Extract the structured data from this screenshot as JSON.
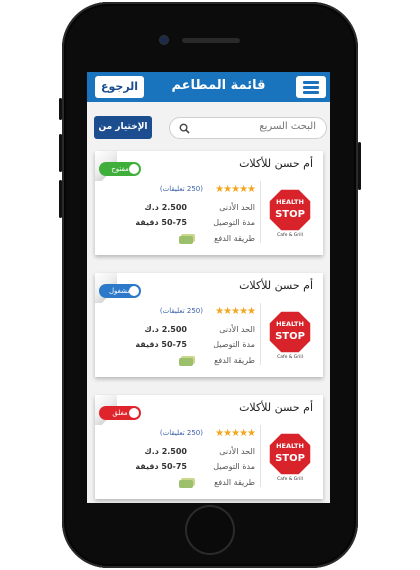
{
  "header": {
    "title": "قائمة المطاعم",
    "back_label": "الرجوع"
  },
  "search": {
    "placeholder": "البحث السريع"
  },
  "filter": {
    "label": "الإختيار من"
  },
  "restaurants": [
    {
      "name": "أم حسن للأكلات",
      "rating": 5,
      "reviews": "(250 تعليقات)",
      "min_label": "الحد الأدنى",
      "min_value": "2.500 د.ك",
      "delivery_label": "مدة التوصيل",
      "delivery_value": "50-75 دقيقة",
      "payment_label": "طريقة الدفع",
      "status": "مفتوح",
      "status_color": "#3fae3a"
    },
    {
      "name": "أم حسن للأكلات",
      "rating": 5,
      "reviews": "(250 تعليقات)",
      "min_label": "الحد الأدنى",
      "min_value": "2.500 د.ك",
      "delivery_label": "مدة التوصيل",
      "delivery_value": "50-75 دقيقة",
      "payment_label": "طريقة الدفع",
      "status": "مشغول",
      "status_color": "#2b79c8"
    },
    {
      "name": "أم حسن للأكلات",
      "rating": 5,
      "reviews": "(250 تعليقات)",
      "min_label": "الحد الأدنى",
      "min_value": "2.500 د.ك",
      "delivery_label": "مدة التوصيل",
      "delivery_value": "50-75 دقيقة",
      "payment_label": "طريقة الدفع",
      "status": "مغلق",
      "status_color": "#e0242c"
    }
  ],
  "logo_text": {
    "line1": "HEALTH",
    "line2": "STOP",
    "line3": "Cafe & Grill"
  },
  "icons": [
    "menu-icon",
    "search-icon",
    "star-icon",
    "cash-icon"
  ]
}
